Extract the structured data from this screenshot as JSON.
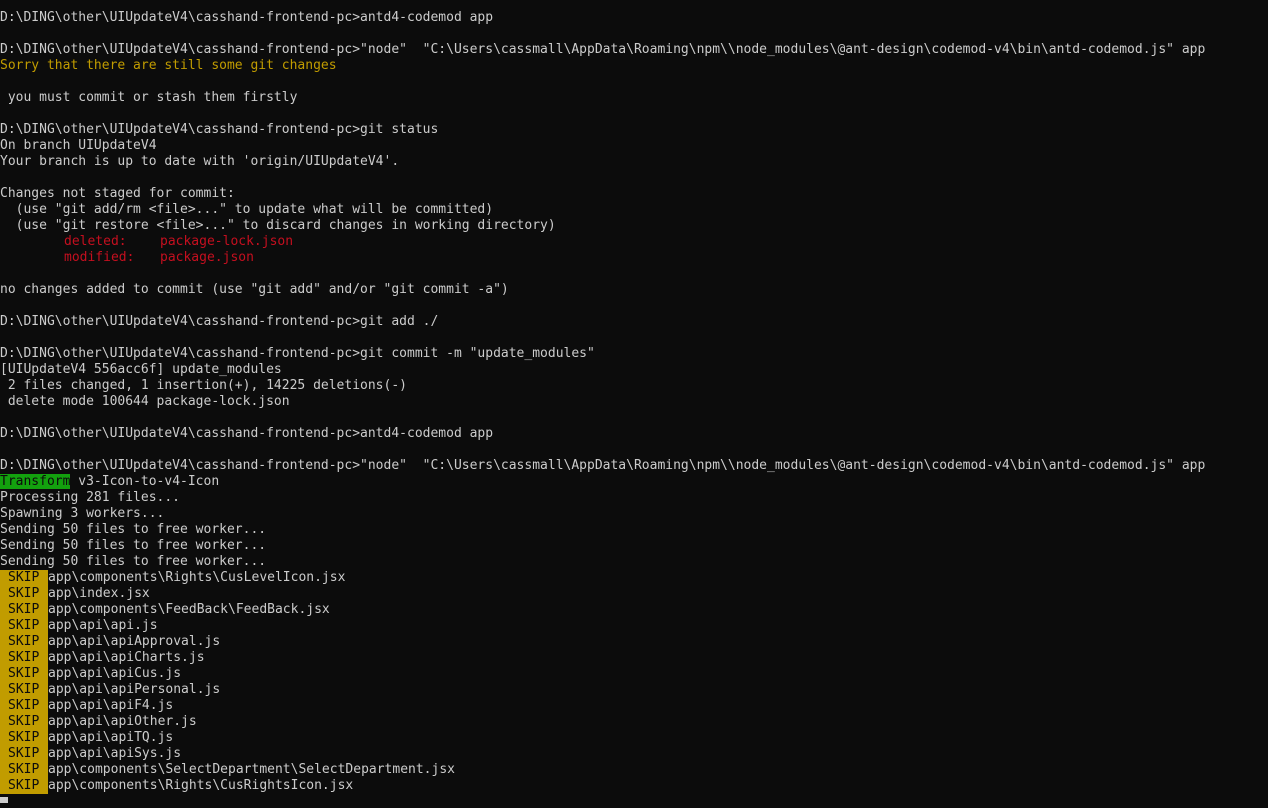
{
  "terminal": {
    "l01": "D:\\DING\\other\\UIUpdateV4\\casshand-frontend-pc>antd4-codemod app",
    "l02": "D:\\DING\\other\\UIUpdateV4\\casshand-frontend-pc>\"node\"  \"C:\\Users\\cassmall\\AppData\\Roaming\\npm\\\\node_modules\\@ant-design\\codemod-v4\\bin\\antd-codemod.js\" app",
    "l03": "Sorry that there are still some git changes",
    "l04": " you must commit or stash them firstly",
    "l05": "D:\\DING\\other\\UIUpdateV4\\casshand-frontend-pc>git status",
    "l06": "On branch UIUpdateV4",
    "l07": "Your branch is up to date with 'origin/UIUpdateV4'.",
    "l08": "Changes not staged for commit:",
    "l09": "  (use \"git add/rm <file>...\" to update what will be committed)",
    "l10": "  (use \"git restore <file>...\" to discard changes in working directory)",
    "l11_label": "deleted:",
    "l11_file": "package-lock.json",
    "l12_label": "modified:",
    "l12_file": "package.json",
    "l13": "no changes added to commit (use \"git add\" and/or \"git commit -a\")",
    "l14": "D:\\DING\\other\\UIUpdateV4\\casshand-frontend-pc>git add ./",
    "l15": "D:\\DING\\other\\UIUpdateV4\\casshand-frontend-pc>git commit -m \"update_modules\"",
    "l16": "[UIUpdateV4 556acc6f] update_modules",
    "l17": " 2 files changed, 1 insertion(+), 14225 deletions(-)",
    "l18": " delete mode 100644 package-lock.json",
    "l19": "D:\\DING\\other\\UIUpdateV4\\casshand-frontend-pc>antd4-codemod app",
    "l20": "D:\\DING\\other\\UIUpdateV4\\casshand-frontend-pc>\"node\"  \"C:\\Users\\cassmall\\AppData\\Roaming\\npm\\\\node_modules\\@ant-design\\codemod-v4\\bin\\antd-codemod.js\" app",
    "transform_tag": "Transform",
    "transform_name": " v3-Icon-to-v4-Icon",
    "l22": "Processing 281 files...",
    "l23": "Spawning 3 workers...",
    "l24": "Sending 50 files to free worker...",
    "l25": "Sending 50 files to free worker...",
    "l26": "Sending 50 files to free worker...",
    "skip_tag": "SKIP",
    "skips": [
      "app\\components\\Rights\\CusLevelIcon.jsx",
      "app\\index.jsx",
      "app\\components\\FeedBack\\FeedBack.jsx",
      "app\\api\\api.js",
      "app\\api\\apiApproval.js",
      "app\\api\\apiCharts.js",
      "app\\api\\apiCus.js",
      "app\\api\\apiPersonal.js",
      "app\\api\\apiF4.js",
      "app\\api\\apiOther.js",
      "app\\api\\apiTQ.js",
      "app\\api\\apiSys.js",
      "app\\components\\SelectDepartment\\SelectDepartment.jsx",
      "app\\components\\Rights\\CusRightsIcon.jsx"
    ]
  },
  "colors": {
    "background": "#0c0c0c",
    "foreground": "#cccccc",
    "warning": "#c19c00",
    "error": "#c50f1f",
    "success": "#13a10e"
  }
}
